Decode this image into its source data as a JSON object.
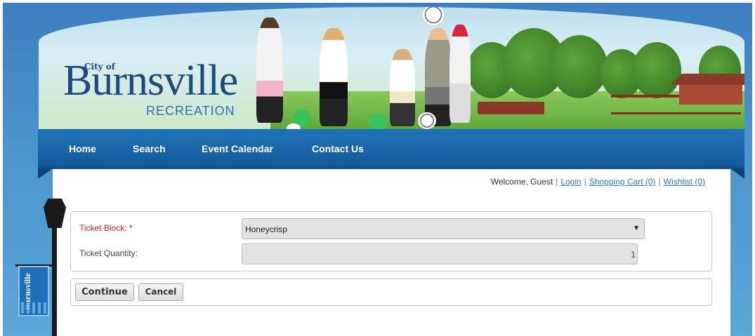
{
  "header": {
    "logo_cityof": "City of",
    "logo_name": "Burnsville",
    "logo_sub": "RECREATION"
  },
  "nav": {
    "items": [
      {
        "label": "Home"
      },
      {
        "label": "Search"
      },
      {
        "label": "Event Calendar"
      },
      {
        "label": "Contact Us"
      }
    ]
  },
  "userbar": {
    "welcome": "Welcome, Guest",
    "login": "Login",
    "cart": "Shopping Cart (0)",
    "wishlist": "Wishlist (0)"
  },
  "form": {
    "ticket_block_label": "Ticket Block: *",
    "ticket_block_value": "Honeycrisp",
    "ticket_quantity_label": "Ticket Quantity:",
    "ticket_quantity_value": "1"
  },
  "actions": {
    "continue_label": "Continue",
    "cancel_label": "Cancel"
  },
  "flag": {
    "text": "Burnsville"
  },
  "colors": {
    "nav_bg": "#1a65a7",
    "required_label": "#cc2222",
    "link": "#2a7ac0"
  }
}
